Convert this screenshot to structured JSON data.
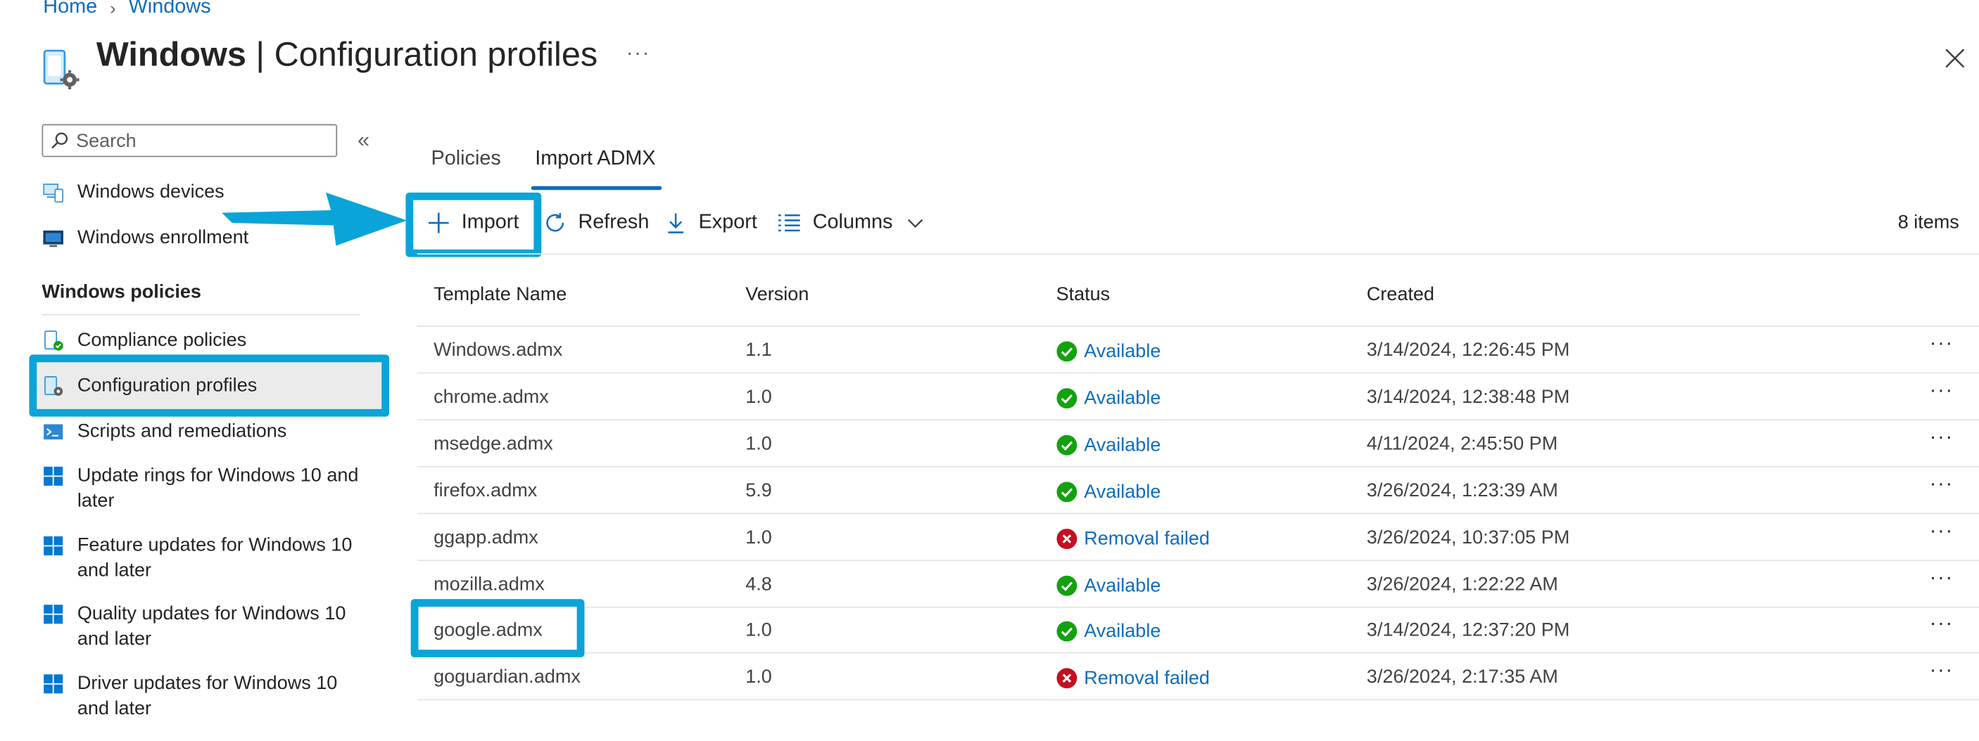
{
  "breadcrumb": {
    "home": "Home",
    "current": "Windows"
  },
  "header": {
    "title_bold": "Windows",
    "title_rest": " | Configuration profiles",
    "more": "···"
  },
  "sidebar": {
    "search_placeholder": "Search",
    "collapse": "«",
    "top_items": [
      {
        "label": "Windows devices",
        "icon": "devices-icon"
      },
      {
        "label": "Windows enrollment",
        "icon": "enrollment-icon"
      }
    ],
    "section_title": "Windows policies",
    "items": [
      {
        "label": "Compliance policies",
        "icon": "compliance-icon"
      },
      {
        "label": "Configuration profiles",
        "icon": "configuration-icon",
        "selected": true
      },
      {
        "label": "Scripts and remediations",
        "icon": "scripts-icon"
      },
      {
        "label": "Update rings for Windows 10 and later",
        "icon": "windows-logo-icon"
      },
      {
        "label": "Feature updates for Windows 10 and later",
        "icon": "windows-logo-icon"
      },
      {
        "label": "Quality updates for Windows 10 and later",
        "icon": "windows-logo-icon"
      },
      {
        "label": "Driver updates for Windows 10 and later",
        "icon": "windows-logo-icon"
      }
    ]
  },
  "tabs": [
    {
      "label": "Policies",
      "active": false
    },
    {
      "label": "Import ADMX",
      "active": true
    }
  ],
  "toolbar": {
    "import": "Import",
    "refresh": "Refresh",
    "export": "Export",
    "columns": "Columns",
    "items_count": "8 items"
  },
  "table": {
    "columns": [
      "Template Name",
      "Version",
      "Status",
      "Created"
    ],
    "rows": [
      {
        "name": "Windows.admx",
        "version": "1.1",
        "status": "Available",
        "ok": true,
        "created": "3/14/2024, 12:26:45 PM"
      },
      {
        "name": "chrome.admx",
        "version": "1.0",
        "status": "Available",
        "ok": true,
        "created": "3/14/2024, 12:38:48 PM"
      },
      {
        "name": "msedge.admx",
        "version": "1.0",
        "status": "Available",
        "ok": true,
        "created": "4/11/2024, 2:45:50 PM"
      },
      {
        "name": "firefox.admx",
        "version": "5.9",
        "status": "Available",
        "ok": true,
        "created": "3/26/2024, 1:23:39 AM"
      },
      {
        "name": "ggapp.admx",
        "version": "1.0",
        "status": "Removal failed",
        "ok": false,
        "created": "3/26/2024, 10:37:05 PM"
      },
      {
        "name": "mozilla.admx",
        "version": "4.8",
        "status": "Available",
        "ok": true,
        "created": "3/26/2024, 1:22:22 AM"
      },
      {
        "name": "google.admx",
        "version": "1.0",
        "status": "Available",
        "ok": true,
        "created": "3/14/2024, 12:37:20 PM"
      },
      {
        "name": "goguardian.admx",
        "version": "1.0",
        "status": "Removal failed",
        "ok": false,
        "created": "3/26/2024, 2:17:35 AM"
      }
    ],
    "row_more": "···"
  },
  "colors": {
    "accent": "#0f6cbd",
    "highlight": "#0aa4d8",
    "success": "#13a10e",
    "error": "#c50f1f"
  }
}
